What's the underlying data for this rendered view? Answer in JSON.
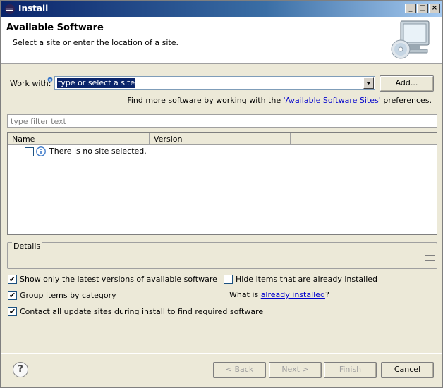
{
  "window": {
    "title": "Install",
    "controls": [
      "_",
      "□",
      "×"
    ]
  },
  "header": {
    "title": "Available Software",
    "subtitle": "Select a site or enter the location of a site."
  },
  "work_with": {
    "label": "Work with:",
    "value": "type or select a site",
    "add_label": "Add..."
  },
  "find_more": {
    "prefix": "Find more software by working with the ",
    "link": "'Available Software Sites'",
    "suffix": " preferences."
  },
  "filter": {
    "placeholder": "type filter text"
  },
  "table": {
    "columns": [
      "Name",
      "Version"
    ],
    "message": "There is no site selected."
  },
  "details": {
    "label": "Details"
  },
  "options": {
    "latest_versions": "Show only the latest versions of available software",
    "hide_installed": "Hide items that are already installed",
    "group_by_category": "Group items by category",
    "what_is": "What is ",
    "already_installed_link": "already installed",
    "question": "?",
    "contact_sites": "Contact all update sites during install to find required software"
  },
  "checkbox_mark": "✔",
  "buttons": {
    "help": "?",
    "back": "< Back",
    "next": "Next >",
    "finish": "Finish",
    "cancel": "Cancel"
  },
  "colors": {
    "title_bar": "#0a246a",
    "link": "#0000cc",
    "selection": "#0a246a"
  },
  "icons": {
    "app": "eclipse-icon",
    "info": "info-icon",
    "banner": "monitor-cd-icon"
  }
}
